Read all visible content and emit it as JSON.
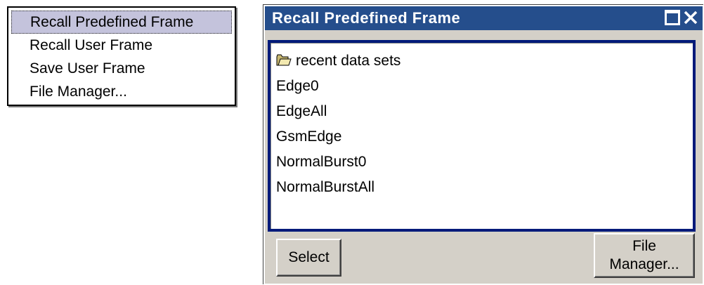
{
  "menu": {
    "items": [
      {
        "label": "Recall Predefined Frame"
      },
      {
        "label": "Recall User Frame"
      },
      {
        "label": "Save User Frame"
      },
      {
        "label": "File Manager..."
      }
    ]
  },
  "dialog": {
    "title": "Recall Predefined Frame",
    "list": {
      "folder": {
        "label": "recent data sets",
        "icon": "folder-icon"
      },
      "items": [
        "Edge0",
        "EdgeAll",
        "GsmEdge",
        "NormalBurst0",
        "NormalBurstAll"
      ]
    },
    "buttons": {
      "select": "Select",
      "file_manager_line1": "File",
      "file_manager_line2": "Manager..."
    }
  },
  "colors": {
    "titlebar": "#254e8c",
    "list_border": "#001a7a",
    "dialog_bg": "#d4d0c8",
    "menu_selection": "#c4c3dc"
  }
}
